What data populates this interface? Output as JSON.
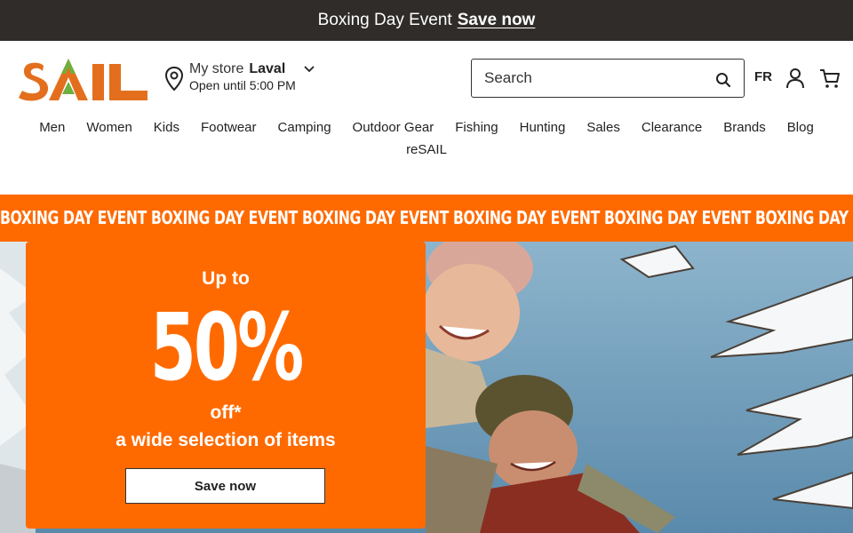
{
  "announcement": {
    "text": "Boxing Day Event",
    "link": "Save now"
  },
  "brand": {
    "logo_text": "SAIL",
    "accent": "#ff6a00",
    "logo_green": "#6fae3f",
    "dark": "#2f2c2a"
  },
  "store": {
    "label": "My store",
    "name": "Laval",
    "hours": "Open until 5:00 PM"
  },
  "search": {
    "placeholder": "Search"
  },
  "header": {
    "language": "FR"
  },
  "nav": {
    "items": [
      "Men",
      "Women",
      "Kids",
      "Footwear",
      "Camping",
      "Outdoor Gear",
      "Fishing",
      "Hunting",
      "Sales",
      "Clearance",
      "Brands",
      "Blog"
    ],
    "second_row": [
      "reSAIL"
    ]
  },
  "marquee": {
    "text": "Boxing Day Event",
    "repeat": 6
  },
  "hero": {
    "up_to": "Up to",
    "percent": "50%",
    "off": "off*",
    "selection": "a wide selection of items",
    "cta": "Save now"
  }
}
